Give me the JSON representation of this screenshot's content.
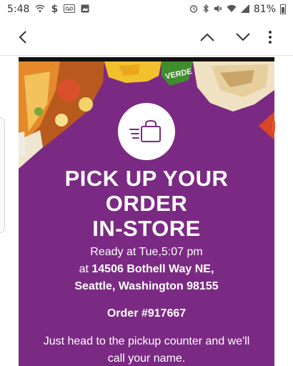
{
  "status_bar": {
    "time": "5:48",
    "battery_percent": "81%",
    "icons_left": [
      "wifi-calling-icon",
      "dollar-icon",
      "voicemail-icon",
      "photo-icon"
    ],
    "icons_right": [
      "alarm-icon",
      "bluetooth-icon",
      "mute-icon",
      "wifi-icon",
      "signal-icon",
      "battery-icon"
    ]
  },
  "app_bar": {
    "icons": [
      "back-arrow-icon",
      "chevron-up-icon",
      "chevron-down-icon",
      "more-vert-icon"
    ]
  },
  "email": {
    "banner_sign_text": "VERDE",
    "title_lines": [
      "PICK UP YOUR",
      "ORDER",
      "IN-STORE"
    ],
    "ready_text": "Ready at Tue,5:07 pm",
    "address_prefix": "at",
    "address_line1": "14506 Bothell Way NE,",
    "address_line2": "Seattle, Washington 98155",
    "order_text": "Order #917667",
    "instructions": "Just head to the pickup counter and we'll call your name.",
    "colors": {
      "background": "#7b2a83",
      "text": "#ffffff"
    }
  }
}
